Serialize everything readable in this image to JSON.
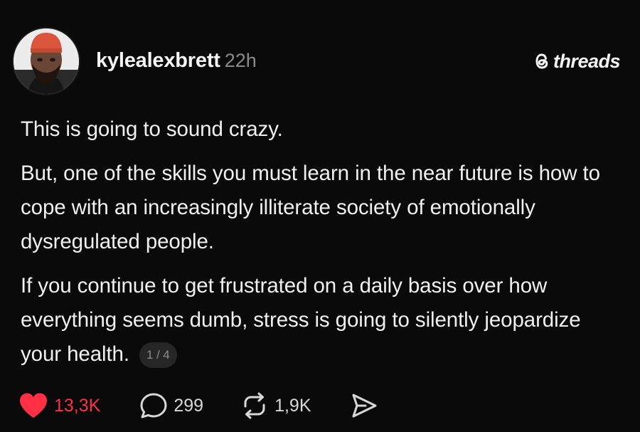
{
  "post": {
    "author": {
      "username": "kylealexbrett",
      "timestamp": "22h",
      "avatar_icon": "profile-photo"
    },
    "brand": {
      "name": "threads",
      "icon": "threads-logo-icon"
    },
    "paragraphs": [
      "This is going to sound crazy.",
      "But, one of the skills you must learn in the near future is how to cope with an increasingly illiterate society of emotionally dysregulated people.",
      "If you continue to get frustrated on a daily basis over how everything seems dumb, stress is going to silently jeopardize your health."
    ],
    "page_indicator": "1 / 4",
    "actions": {
      "likes": "13,3K",
      "replies": "299",
      "reposts": "1,9K"
    },
    "colors": {
      "background": "#0a0a0a",
      "like": "#ff3045",
      "muted_text": "#8a8a8a"
    }
  }
}
